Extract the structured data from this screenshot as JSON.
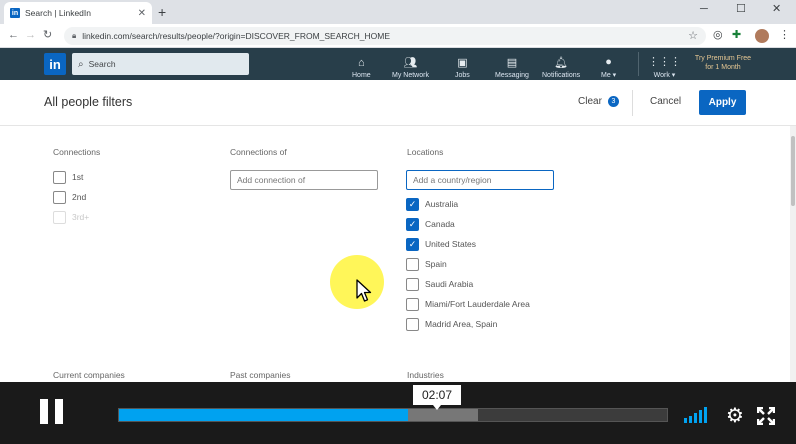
{
  "browser": {
    "tab_title": "Search | LinkedIn",
    "tab_favicon": "in",
    "url": "linkedin.com/search/results/people/?origin=DISCOVER_FROM_SEARCH_HOME"
  },
  "navbar": {
    "logo": "in",
    "search_placeholder": "Search",
    "items": [
      {
        "label": "Home",
        "icon": "home-icon"
      },
      {
        "label": "My Network",
        "icon": "network-icon"
      },
      {
        "label": "Jobs",
        "icon": "briefcase-icon"
      },
      {
        "label": "Messaging",
        "icon": "chat-icon"
      },
      {
        "label": "Notifications",
        "icon": "bell-icon"
      },
      {
        "label": "Me ▾",
        "icon": "avatar-icon"
      },
      {
        "label": "Work ▾",
        "icon": "grid-icon"
      }
    ],
    "premium_line1": "Try Premium Free",
    "premium_line2": "for 1 Month"
  },
  "filters": {
    "title": "All people filters",
    "clear_label": "Clear",
    "clear_count": "3",
    "cancel_label": "Cancel",
    "apply_label": "Apply",
    "connections": {
      "label": "Connections",
      "options": [
        {
          "label": "1st",
          "checked": false,
          "disabled": false
        },
        {
          "label": "2nd",
          "checked": false,
          "disabled": false
        },
        {
          "label": "3rd+",
          "checked": false,
          "disabled": true
        }
      ]
    },
    "connections_of": {
      "label": "Connections of",
      "placeholder": "Add connection of"
    },
    "locations": {
      "label": "Locations",
      "placeholder": "Add a country/region",
      "options": [
        {
          "label": "Australia",
          "checked": true
        },
        {
          "label": "Canada",
          "checked": true
        },
        {
          "label": "United States",
          "checked": true
        },
        {
          "label": "Spain",
          "checked": false
        },
        {
          "label": "Saudi Arabia",
          "checked": false
        },
        {
          "label": "Miami/Fort Lauderdale Area",
          "checked": false
        },
        {
          "label": "Madrid Area, Spain",
          "checked": false
        }
      ]
    },
    "current_companies_label": "Current companies",
    "past_companies_label": "Past companies",
    "industries_label": "Industries"
  },
  "player": {
    "time": "02:07",
    "progress": 0.528,
    "buffered": 0.655
  },
  "colors": {
    "linkedin_blue": "#0a66c2",
    "nav_bg": "#283e4a",
    "progress": "#00a2f0"
  }
}
